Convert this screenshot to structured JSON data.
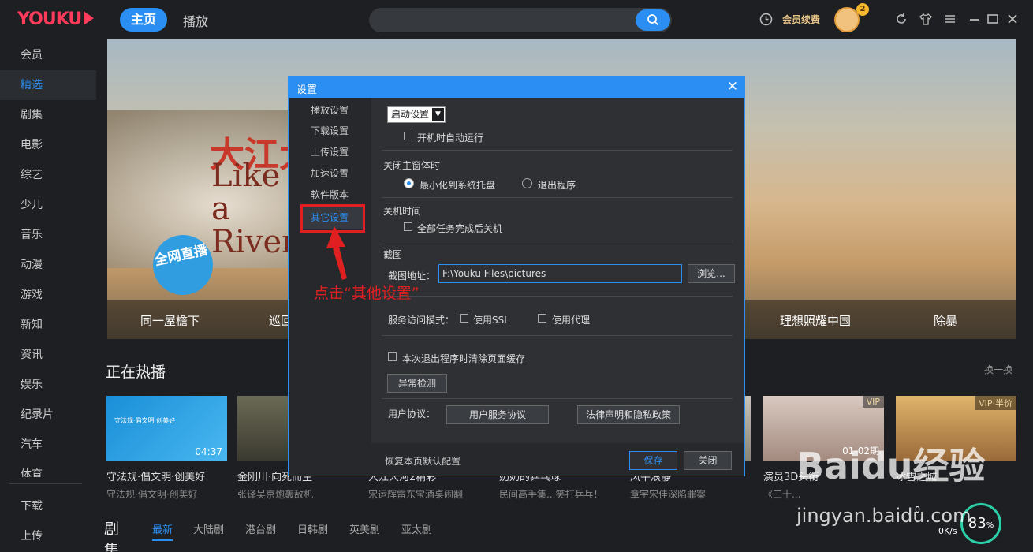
{
  "app": {
    "logo": "YOUKU"
  },
  "header": {
    "nav": [
      "主页",
      "播放"
    ],
    "vip_renew": "会员续费",
    "avatar_badge": "2"
  },
  "sidebar": {
    "items": [
      "会员",
      "精选",
      "剧集",
      "电影",
      "综艺",
      "少儿",
      "音乐",
      "动漫",
      "游戏",
      "新知",
      "资讯",
      "娱乐",
      "纪录片",
      "汽车",
      "体育"
    ],
    "active": "精选",
    "bottom": [
      "下载",
      "上传"
    ]
  },
  "banner": {
    "title": "大江大",
    "subtitle": "Like a River",
    "badge": "全网直播",
    "strip": [
      "同一屋檐下",
      "巡回",
      "理想照耀中国",
      "除暴"
    ]
  },
  "hot": {
    "title": "正在热播",
    "refresh": "换一换",
    "cards": [
      {
        "title": "守法规·倡文明·创美好",
        "sub": "守法规·倡文明·创美好",
        "duration": "04:37",
        "thumb_text": "守法规·倡文明·创美好"
      },
      {
        "title": "金刚川·向死而生",
        "sub": "张译吴京炮轰敌机"
      },
      {
        "title": "大江大河2精彩",
        "sub": "宋运辉雷东宝酒桌闹翻"
      },
      {
        "title": "奶奶的乒乓球",
        "sub": "民间高手集...笑打乒乓！"
      },
      {
        "title": "风平浪静",
        "sub": "章宇宋佳深陷罪案"
      },
      {
        "title": "演员3D头衔",
        "sub": "《三十...",
        "tag": "VIP",
        "date": "01-02期"
      },
      {
        "title": "冰雪之城",
        "sub": "",
        "tag": "VIP·半价"
      }
    ]
  },
  "drama": {
    "title": "剧集",
    "tabs": [
      "最新",
      "大陆剧",
      "港台剧",
      "日韩剧",
      "英美剧",
      "亚太剧"
    ],
    "active": "最新"
  },
  "dialog": {
    "title": "设置",
    "nav": [
      "播放设置",
      "下载设置",
      "上传设置",
      "加速设置",
      "软件版本",
      "其它设置"
    ],
    "active_nav": "其它设置",
    "startup_select": "启动设置",
    "autorun": "开机时自动运行",
    "close_title": "关闭主窗体时",
    "close_opt1": "最小化到系统托盘",
    "close_opt2": "退出程序",
    "shutdown_title": "关机时间",
    "shutdown_opt": "全部任务完成后关机",
    "screenshot_title": "截图",
    "screenshot_label": "截图地址：",
    "screenshot_path": "F:\\Youku Files\\pictures",
    "browse": "浏览...",
    "service_label": "服务访问模式：",
    "use_ssl": "使用SSL",
    "use_proxy": "使用代理",
    "clear_cache": "本次退出程序时清除页面缓存",
    "detect": "异常检测",
    "agreement_label": "用户协议：",
    "user_agreement": "用户服务协议",
    "legal": "法律声明和隐私政策",
    "restore": "恢复本页默认配置",
    "save": "保存",
    "close": "关闭"
  },
  "annotation": "点击“其他设置”",
  "status": {
    "speed_up": "0",
    "speed_down": "0K/s",
    "gauge": "83",
    "gauge_unit": "%"
  },
  "watermark": {
    "main": "Baidu经验",
    "url": "jingyan.baidu.com"
  }
}
